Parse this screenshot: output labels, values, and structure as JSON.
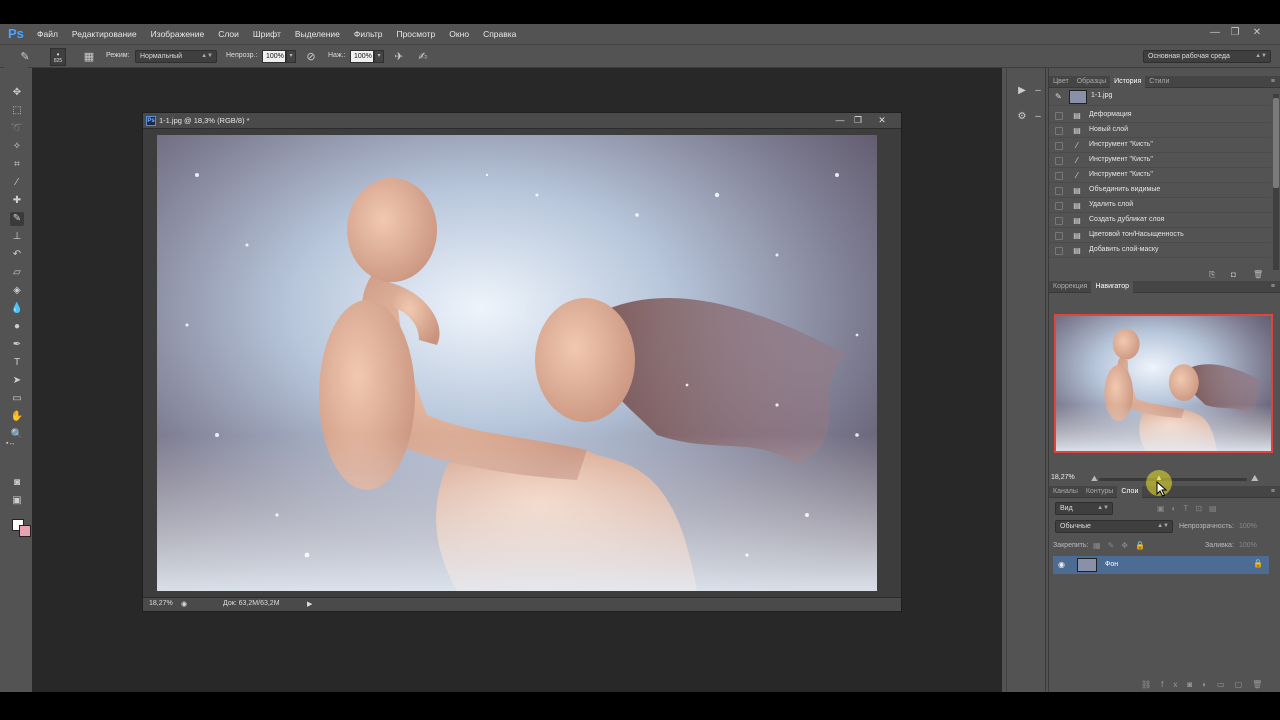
{
  "app": {
    "logo": "Ps",
    "menu": [
      "Файл",
      "Редактирование",
      "Изображение",
      "Слои",
      "Шрифт",
      "Выделение",
      "Фильтр",
      "Просмотр",
      "Окно",
      "Справка"
    ],
    "window_controls": [
      "—",
      "❐",
      "✕"
    ],
    "workspace_preset": "Основная рабочая среда"
  },
  "options": {
    "brush_size": "825",
    "mode_label": "Режим:",
    "mode_value": "Нормальный",
    "opacity_label": "Непрозр.:",
    "opacity_value": "100%",
    "pressure_label": "Наж.:",
    "pressure_value": "100%"
  },
  "document": {
    "title": "1-1.jpg @ 18,3% (RGB/8) *",
    "zoom": "18,27%",
    "doc_size": "Док: 63,2M/63,2M"
  },
  "history": {
    "tabs": [
      "Цвет",
      "Образцы",
      "История",
      "Стили"
    ],
    "active_tab": "История",
    "snapshot": "1-1.jpg",
    "items": [
      {
        "label": "Деформация",
        "icon": "doc-icon"
      },
      {
        "label": "Новый слой",
        "icon": "doc-icon"
      },
      {
        "label": "Инструмент \"Кисть\"",
        "icon": "brush-icon"
      },
      {
        "label": "Инструмент \"Кисть\"",
        "icon": "brush-icon"
      },
      {
        "label": "Инструмент \"Кисть\"",
        "icon": "brush-icon"
      },
      {
        "label": "Объединить видимые",
        "icon": "doc-icon"
      },
      {
        "label": "Удалить слой",
        "icon": "doc-icon"
      },
      {
        "label": "Создать дубликат слоя",
        "icon": "doc-icon"
      },
      {
        "label": "Цветовой тон/Насыщенность",
        "icon": "doc-icon"
      },
      {
        "label": "Добавить слой-маску",
        "icon": "doc-icon"
      }
    ]
  },
  "navigator": {
    "tabs": [
      "Коррекция",
      "Навигатор"
    ],
    "active_tab": "Навигатор",
    "zoom": "18,27%"
  },
  "layers": {
    "tabs": [
      "Каналы",
      "Контуры",
      "Слои"
    ],
    "active_tab": "Слои",
    "filter": "Вид",
    "blend_mode": "Обычные",
    "opacity_label": "Непрозрачность:",
    "opacity_value": "100%",
    "lock_label": "Закрепить:",
    "fill_label": "Заливка:",
    "fill_value": "100%",
    "items": [
      {
        "name": "Фон",
        "visible": true,
        "locked": true
      }
    ]
  },
  "colors": {
    "foreground": "#ffffff",
    "background": "#e6a3ad",
    "accent": "#e0443c",
    "selected_layer": "#4d6c93"
  }
}
